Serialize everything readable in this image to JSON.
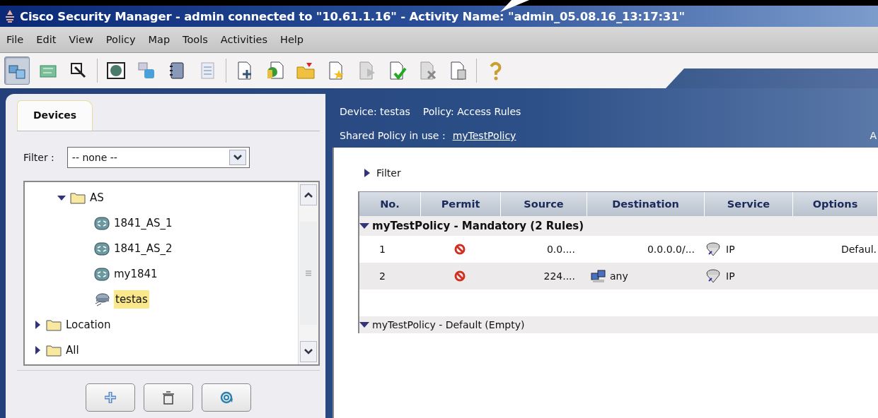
{
  "window": {
    "title": "Cisco Security Manager  - admin connected to \"10.61.1.16\" - Activity Name: \"admin_05.08.16_13:17:31\""
  },
  "menu": [
    "File",
    "Edit",
    "View",
    "Policy",
    "Map",
    "Tools",
    "Activities",
    "Help"
  ],
  "toolbar": [
    {
      "kind": "devices",
      "selected": true
    },
    {
      "kind": "map",
      "selected": false
    },
    {
      "kind": "select",
      "selected": false
    },
    {
      "kind": "separator"
    },
    {
      "kind": "globe",
      "selected": false
    },
    {
      "kind": "share",
      "selected": false
    },
    {
      "kind": "book",
      "selected": false
    },
    {
      "kind": "checklist",
      "selected": false
    },
    {
      "kind": "separator"
    },
    {
      "kind": "page-add",
      "selected": false
    },
    {
      "kind": "page-refresh",
      "selected": false
    },
    {
      "kind": "folder-open",
      "selected": false
    },
    {
      "kind": "page-star",
      "selected": false
    },
    {
      "kind": "page-arrow",
      "selected": false
    },
    {
      "kind": "page-check",
      "selected": false
    },
    {
      "kind": "page-x",
      "selected": false
    },
    {
      "kind": "page-bin",
      "selected": false
    },
    {
      "kind": "separator"
    },
    {
      "kind": "help",
      "selected": false
    }
  ],
  "sidebar": {
    "tabs": [
      {
        "label": "Devices",
        "selected": true
      }
    ],
    "filter": {
      "label": "Filter :",
      "value": "-- none --"
    },
    "tree": [
      {
        "children": [
          {
            "label": "AS",
            "kind": "folder",
            "expanded": true,
            "selected": false,
            "children": [
              {
                "label": "1841_AS_1",
                "kind": "router",
                "selected": false
              },
              {
                "label": "1841_AS_2",
                "kind": "router",
                "selected": false
              },
              {
                "label": "my1841",
                "kind": "router",
                "selected": false
              },
              {
                "label": "testas",
                "kind": "switch",
                "selected": true
              }
            ]
          }
        ]
      },
      {
        "label": "Location",
        "kind": "folder",
        "expanded": false,
        "selected": false
      },
      {
        "label": "All",
        "kind": "folder",
        "expanded": false,
        "selected": false
      }
    ],
    "buttons": [
      {
        "kind": "add"
      },
      {
        "kind": "delete"
      },
      {
        "kind": "refresh"
      }
    ]
  },
  "content": {
    "device": "Device: testas",
    "policy": "Policy: Access Rules",
    "shared_label": "Shared Policy in use  :",
    "shared_link": "myTestPolicy",
    "header_right": "A",
    "filter": {
      "label": "Filter",
      "expanded": false
    },
    "table": {
      "columns": [
        "No.",
        "Permit",
        "Source",
        "Destination",
        "Service",
        "Options"
      ],
      "groups": [
        {
          "title": "myTestPolicy - Mandatory (2 Rules)",
          "expanded": true,
          "rules": [
            {
              "no": "1",
              "permit": false,
              "source": "0.0....",
              "destination": {
                "text": "0.0.0.0/...",
                "kind": "address"
              },
              "service": "IP",
              "options": "Defaul."
            },
            {
              "no": "2",
              "permit": false,
              "source": "224....",
              "destination": {
                "text": "any",
                "kind": "network"
              },
              "service": "IP"
            }
          ]
        },
        {
          "title": "myTestPolicy - Default (Empty)",
          "expanded": true
        }
      ]
    }
  }
}
